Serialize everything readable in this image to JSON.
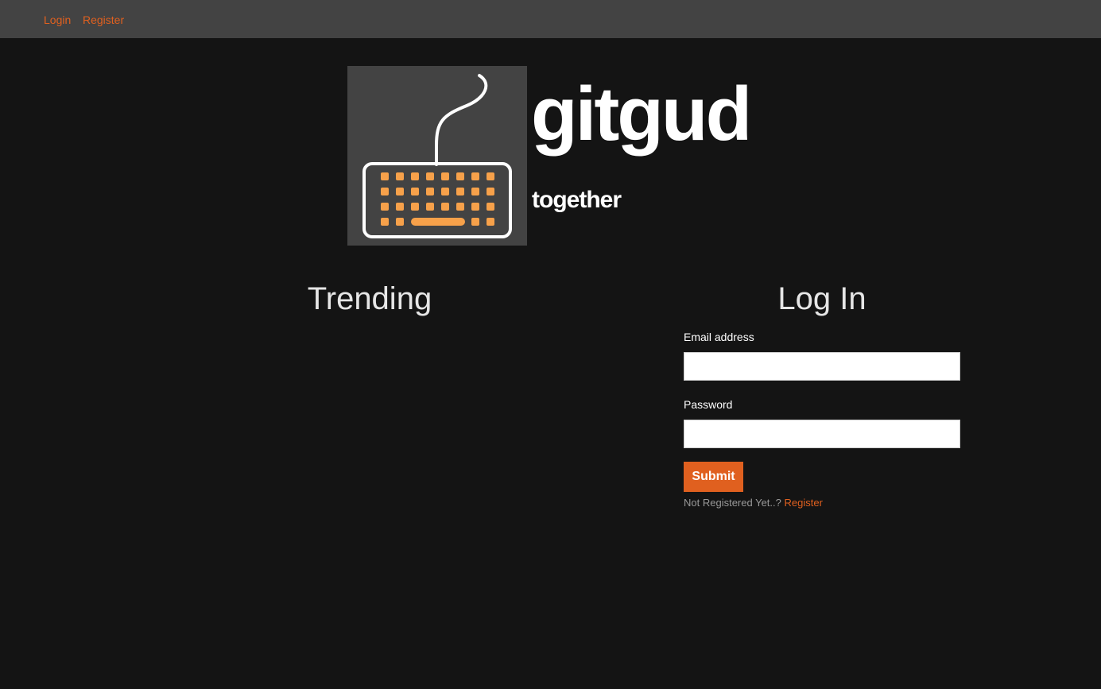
{
  "nav": {
    "login_label": "Login",
    "register_label": "Register"
  },
  "brand": {
    "name": "gitgud",
    "tagline": "together",
    "logo_icon": "keyboard-icon"
  },
  "trending": {
    "title": "Trending"
  },
  "login_form": {
    "title": "Log In",
    "email_label": "Email address",
    "email_value": "",
    "password_label": "Password",
    "password_value": "",
    "submit_label": "Submit",
    "not_registered_text": "Not Registered Yet..?",
    "register_link_label": "Register"
  },
  "colors": {
    "accent": "#e0601f",
    "background": "#141414",
    "topbar": "#434343",
    "logo_keys": "#f7a14a"
  }
}
